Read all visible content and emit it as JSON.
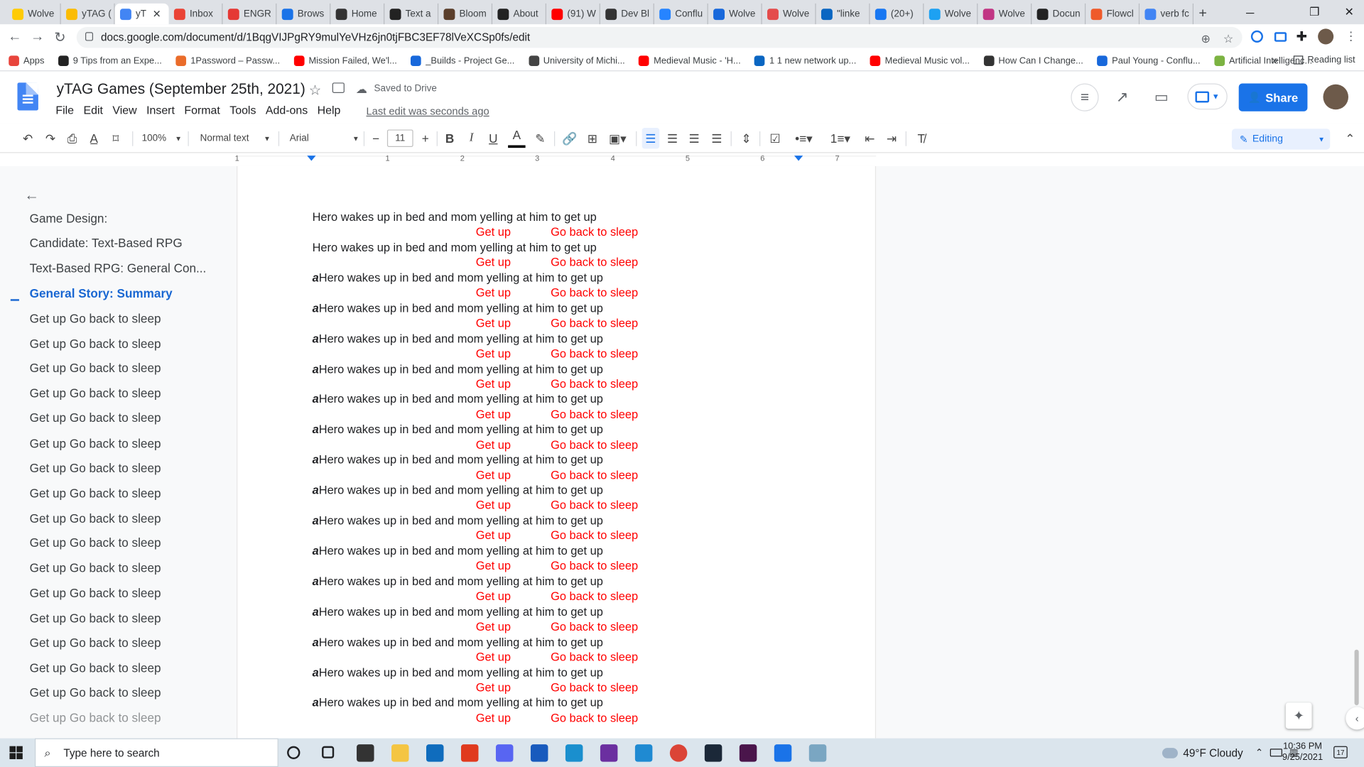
{
  "browser": {
    "tabs": [
      {
        "label": "Wolve",
        "color": "#ffcb05"
      },
      {
        "label": "yTAG (",
        "color": "#fbbc04"
      },
      {
        "label": "yT",
        "color": "#4285f4",
        "active": true
      },
      {
        "label": "Inbox",
        "color": "#ea4335"
      },
      {
        "label": "ENGR",
        "color": "#e53935"
      },
      {
        "label": "Brows",
        "color": "#1a73e8"
      },
      {
        "label": "Home",
        "color": "#333333"
      },
      {
        "label": "Text a",
        "color": "#222222"
      },
      {
        "label": "Bloom",
        "color": "#5a3e2b"
      },
      {
        "label": "About",
        "color": "#222222"
      },
      {
        "label": "(91) W",
        "color": "#ff0000"
      },
      {
        "label": "Dev Bl",
        "color": "#333333"
      },
      {
        "label": "Conflu",
        "color": "#2684ff"
      },
      {
        "label": "Wolve",
        "color": "#1868db"
      },
      {
        "label": "Wolve",
        "color": "#e44c4c"
      },
      {
        "label": "\"linke",
        "color": "#0a66c2"
      },
      {
        "label": "(20+)",
        "color": "#1877f2"
      },
      {
        "label": "Wolve",
        "color": "#1da1f2"
      },
      {
        "label": "Wolve",
        "color": "#c13584"
      },
      {
        "label": "Docun",
        "color": "#222222"
      },
      {
        "label": "Flowcl",
        "color": "#ef5a2a"
      },
      {
        "label": "verb fc",
        "color": "#4285f4"
      }
    ],
    "close_tab": "✕",
    "new_tab": "+",
    "url": "docs.google.com/document/d/1BqgVIJPgRY9mulYeVHz6jn0tjFBC3EF78lVeXCSp0fs/edit",
    "bookmarks": [
      {
        "label": "Apps",
        "color": "#e8453c"
      },
      {
        "label": "9 Tips from an Expe...",
        "color": "#222222"
      },
      {
        "label": "1Password – Passw...",
        "color": "#ea6c2a"
      },
      {
        "label": "Mission Failed, We'l...",
        "color": "#ff0000"
      },
      {
        "label": "_Builds - Project Ge...",
        "color": "#1868db"
      },
      {
        "label": "University of Michi...",
        "color": "#444444"
      },
      {
        "label": "Medieval Music - 'H...",
        "color": "#ff0000"
      },
      {
        "label": "1 1 new network up...",
        "color": "#0a66c2"
      },
      {
        "label": "Medieval Music vol...",
        "color": "#ff0000"
      },
      {
        "label": "How Can I Change...",
        "color": "#333333"
      },
      {
        "label": "Paul Young - Conflu...",
        "color": "#1868db"
      },
      {
        "label": "Artificial Intelligenc...",
        "color": "#7cb342"
      }
    ],
    "bookmarks_more": "»",
    "reading_list": "Reading list"
  },
  "doc": {
    "title": "yTAG Games (September 25th, 2021)",
    "saved": "Saved to Drive",
    "menu": [
      "File",
      "Edit",
      "View",
      "Insert",
      "Format",
      "Tools",
      "Add-ons",
      "Help"
    ],
    "last_edit": "Last edit was seconds ago",
    "share": "Share"
  },
  "toolbar": {
    "zoom": "100%",
    "style": "Normal text",
    "font": "Arial",
    "size": "11",
    "mode": "Editing"
  },
  "ruler": [
    "1",
    "1",
    "2",
    "3",
    "4",
    "5",
    "6",
    "7"
  ],
  "outline": {
    "items": [
      "Game Design:",
      "Candidate: Text-Based RPG",
      "Text-Based RPG: General Con...",
      "General Story: Summary",
      "Get up Go back to sleep",
      "Get up Go back to sleep",
      "Get up Go back to sleep",
      "Get up Go back to sleep",
      "Get up Go back to sleep",
      "Get up Go back to sleep",
      "Get up Go back to sleep",
      "Get up Go back to sleep",
      "Get up Go back to sleep",
      "Get up Go back to sleep",
      "Get up Go back to sleep",
      "Get up Go back to sleep",
      "Get up Go back to sleep",
      "Get up Go back to sleep",
      "Get up Go back to sleep",
      "Get up Go back to sleep",
      "Get up Go back to sleep"
    ],
    "active_index": 3
  },
  "content": {
    "first_lines": [
      "Hero wakes up in bed and mom yelling at him to get up",
      "Hero wakes up in bed and mom yelling at him to get up"
    ],
    "prefix": "a",
    "line": "Hero wakes up in bed and mom yelling at him to get up",
    "choice_a": "Get up",
    "choice_b": "Go back to sleep",
    "repeat_count": 15
  },
  "taskbar": {
    "search_placeholder": "Type here to search",
    "weather": "49°F  Cloudy",
    "time": "10:36 PM",
    "date": "9/25/2021",
    "notifications": "17",
    "apps": [
      {
        "name": "cortana-icon",
        "color": "#202124"
      },
      {
        "name": "task-view-icon",
        "color": "#202124"
      },
      {
        "name": "store-icon",
        "color": "#333333"
      },
      {
        "name": "file-explorer-icon",
        "color": "#f4c542"
      },
      {
        "name": "mail-icon",
        "color": "#0f6cbd"
      },
      {
        "name": "office-icon",
        "color": "#e03a1e"
      },
      {
        "name": "discord-icon",
        "color": "#5865f2"
      },
      {
        "name": "word-icon",
        "color": "#185abd"
      },
      {
        "name": "edge-icon",
        "color": "#1a8fce"
      },
      {
        "name": "obs-icon",
        "color": "#6b2fa0"
      },
      {
        "name": "vscode-icon",
        "color": "#1f8ad2"
      },
      {
        "name": "chrome-icon",
        "color": "#db4437"
      },
      {
        "name": "steam-icon",
        "color": "#1b2838"
      },
      {
        "name": "slack-icon",
        "color": "#4a154b"
      },
      {
        "name": "dots-app-icon",
        "color": "#1a73e8"
      },
      {
        "name": "window-app-icon",
        "color": "#7aa6c2"
      }
    ]
  }
}
